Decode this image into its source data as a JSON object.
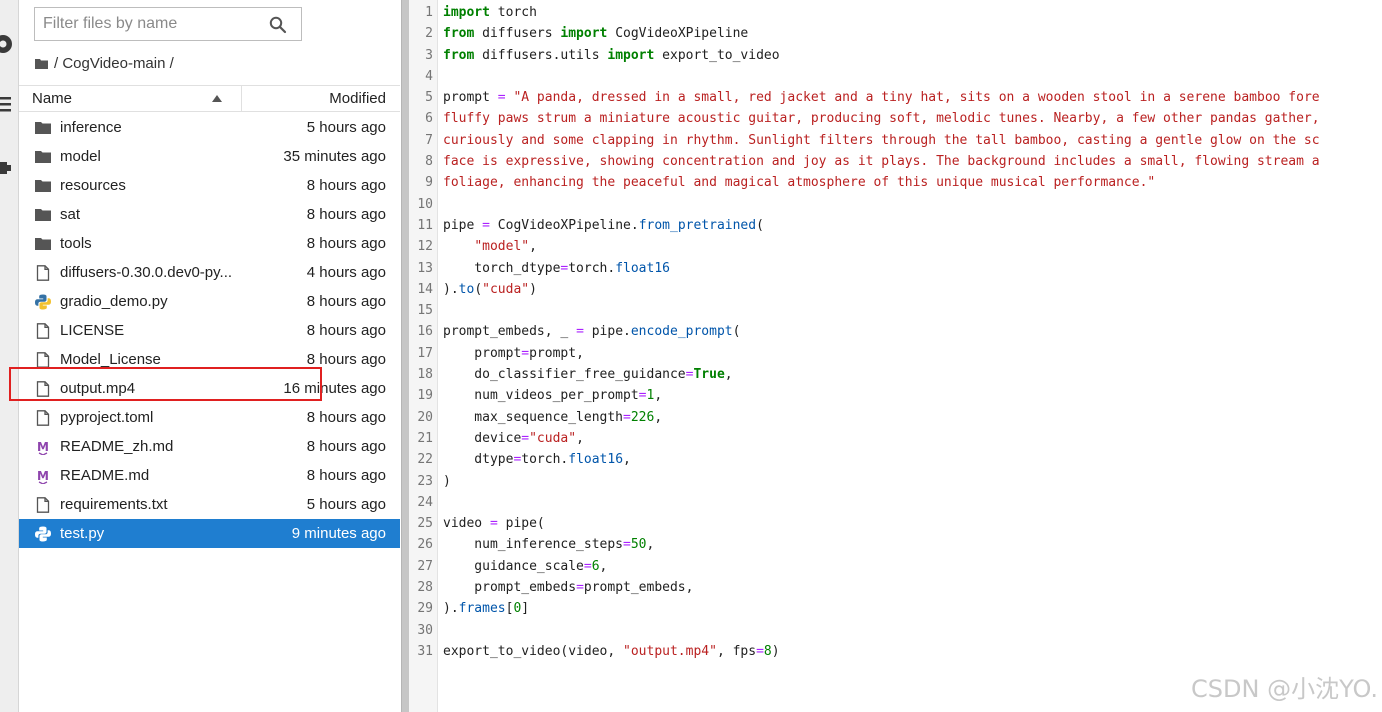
{
  "sidebar": {
    "filter_placeholder": "Filter files by name",
    "breadcrumb": "/ CogVideo-main /",
    "columns": {
      "name": "Name",
      "modified": "Modified"
    },
    "files": [
      {
        "name": "inference",
        "modified": "5 hours ago",
        "icon": "folder-icon",
        "selected": false
      },
      {
        "name": "model",
        "modified": "35 minutes ago",
        "icon": "folder-icon",
        "selected": false
      },
      {
        "name": "resources",
        "modified": "8 hours ago",
        "icon": "folder-icon",
        "selected": false
      },
      {
        "name": "sat",
        "modified": "8 hours ago",
        "icon": "folder-icon",
        "selected": false
      },
      {
        "name": "tools",
        "modified": "8 hours ago",
        "icon": "folder-icon",
        "selected": false
      },
      {
        "name": "diffusers-0.30.0.dev0-py...",
        "modified": "4 hours ago",
        "icon": "file-icon",
        "selected": false
      },
      {
        "name": "gradio_demo.py",
        "modified": "8 hours ago",
        "icon": "python-icon",
        "selected": false
      },
      {
        "name": "LICENSE",
        "modified": "8 hours ago",
        "icon": "file-icon",
        "selected": false
      },
      {
        "name": "Model_License",
        "modified": "8 hours ago",
        "icon": "file-icon",
        "selected": false
      },
      {
        "name": "output.mp4",
        "modified": "16 minutes ago",
        "icon": "file-icon",
        "selected": false
      },
      {
        "name": "pyproject.toml",
        "modified": "8 hours ago",
        "icon": "file-icon",
        "selected": false
      },
      {
        "name": "README_zh.md",
        "modified": "8 hours ago",
        "icon": "markdown-icon",
        "selected": false
      },
      {
        "name": "README.md",
        "modified": "8 hours ago",
        "icon": "markdown-icon",
        "selected": false
      },
      {
        "name": "requirements.txt",
        "modified": "5 hours ago",
        "icon": "file-icon",
        "selected": false
      },
      {
        "name": "test.py",
        "modified": "9 minutes ago",
        "icon": "python-icon",
        "selected": true
      }
    ]
  },
  "editor": {
    "lines": [
      [
        [
          "kw",
          "import"
        ],
        [
          "t",
          " torch"
        ]
      ],
      [
        [
          "kw",
          "from"
        ],
        [
          "t",
          " diffusers "
        ],
        [
          "kw",
          "import"
        ],
        [
          "t",
          " CogVideoXPipeline"
        ]
      ],
      [
        [
          "kw",
          "from"
        ],
        [
          "t",
          " diffusers.utils "
        ],
        [
          "kw",
          "import"
        ],
        [
          "t",
          " export_to_video"
        ]
      ],
      [],
      [
        [
          "t",
          "prompt "
        ],
        [
          "op",
          "="
        ],
        [
          "t",
          " "
        ],
        [
          "str",
          "\"A panda, dressed in a small, red jacket and a tiny hat, sits on a wooden stool in a serene bamboo fore"
        ]
      ],
      [
        [
          "str",
          "fluffy paws strum a miniature acoustic guitar, producing soft, melodic tunes. Nearby, a few other pandas gather,"
        ]
      ],
      [
        [
          "str",
          "curiously and some clapping in rhythm. Sunlight filters through the tall bamboo, casting a gentle glow on the sc"
        ]
      ],
      [
        [
          "str",
          "face is expressive, showing concentration and joy as it plays. The background includes a small, flowing stream a"
        ]
      ],
      [
        [
          "str",
          "foliage, enhancing the peaceful and magical atmosphere of this unique musical performance.\""
        ]
      ],
      [],
      [
        [
          "t",
          "pipe "
        ],
        [
          "op",
          "="
        ],
        [
          "t",
          " CogVideoXPipeline."
        ],
        [
          "attr",
          "from_pretrained"
        ],
        [
          "t",
          "("
        ]
      ],
      [
        [
          "t",
          "    "
        ],
        [
          "str",
          "\"model\""
        ],
        [
          "t",
          ","
        ]
      ],
      [
        [
          "t",
          "    torch_dtype"
        ],
        [
          "op",
          "="
        ],
        [
          "t",
          "torch."
        ],
        [
          "attr",
          "float16"
        ]
      ],
      [
        [
          "t",
          ")."
        ],
        [
          "attr",
          "to"
        ],
        [
          "t",
          "("
        ],
        [
          "str",
          "\"cuda\""
        ],
        [
          "t",
          ")"
        ]
      ],
      [],
      [
        [
          "t",
          "prompt_embeds, _ "
        ],
        [
          "op",
          "="
        ],
        [
          "t",
          " pipe."
        ],
        [
          "attr",
          "encode_prompt"
        ],
        [
          "t",
          "("
        ]
      ],
      [
        [
          "t",
          "    prompt"
        ],
        [
          "op",
          "="
        ],
        [
          "t",
          "prompt,"
        ]
      ],
      [
        [
          "t",
          "    do_classifier_free_guidance"
        ],
        [
          "op",
          "="
        ],
        [
          "kw",
          "True"
        ],
        [
          "t",
          ","
        ]
      ],
      [
        [
          "t",
          "    num_videos_per_prompt"
        ],
        [
          "op",
          "="
        ],
        [
          "num",
          "1"
        ],
        [
          "t",
          ","
        ]
      ],
      [
        [
          "t",
          "    max_sequence_length"
        ],
        [
          "op",
          "="
        ],
        [
          "num",
          "226"
        ],
        [
          "t",
          ","
        ]
      ],
      [
        [
          "t",
          "    device"
        ],
        [
          "op",
          "="
        ],
        [
          "str",
          "\"cuda\""
        ],
        [
          "t",
          ","
        ]
      ],
      [
        [
          "t",
          "    dtype"
        ],
        [
          "op",
          "="
        ],
        [
          "t",
          "torch."
        ],
        [
          "attr",
          "float16"
        ],
        [
          "t",
          ","
        ]
      ],
      [
        [
          "t",
          ")"
        ]
      ],
      [],
      [
        [
          "t",
          "video "
        ],
        [
          "op",
          "="
        ],
        [
          "t",
          " pipe("
        ]
      ],
      [
        [
          "t",
          "    num_inference_steps"
        ],
        [
          "op",
          "="
        ],
        [
          "num",
          "50"
        ],
        [
          "t",
          ","
        ]
      ],
      [
        [
          "t",
          "    guidance_scale"
        ],
        [
          "op",
          "="
        ],
        [
          "num",
          "6"
        ],
        [
          "t",
          ","
        ]
      ],
      [
        [
          "t",
          "    prompt_embeds"
        ],
        [
          "op",
          "="
        ],
        [
          "t",
          "prompt_embeds,"
        ]
      ],
      [
        [
          "t",
          ")."
        ],
        [
          "attr",
          "frames"
        ],
        [
          "t",
          "["
        ],
        [
          "num",
          "0"
        ],
        [
          "t",
          "]"
        ]
      ],
      [],
      [
        [
          "t",
          "export_to_video(video, "
        ],
        [
          "str",
          "\"output.mp4\""
        ],
        [
          "t",
          ", fps"
        ],
        [
          "op",
          "="
        ],
        [
          "num",
          "8"
        ],
        [
          "t",
          ")"
        ]
      ]
    ]
  },
  "watermark": "CSDN @小沈YO.",
  "colors": {
    "selected_row": "#1f7ed0",
    "highlight_box": "#e02020",
    "keyword": "#008000",
    "string": "#ba2121",
    "operator": "#aa22ff",
    "attribute": "#0055aa"
  }
}
